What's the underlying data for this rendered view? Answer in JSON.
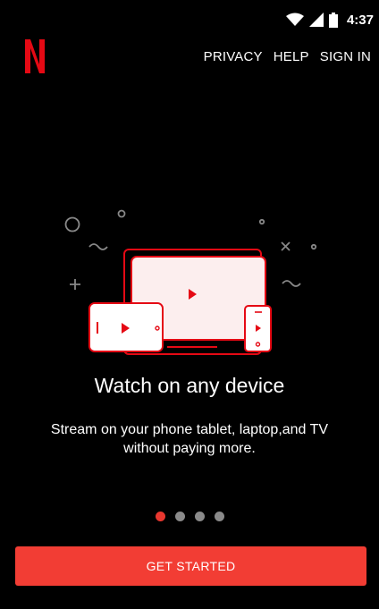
{
  "status_bar": {
    "time": "4:37",
    "icons": [
      "wifi-icon",
      "cell-signal-icon",
      "battery-icon"
    ]
  },
  "header": {
    "logo": "netflix-logo",
    "nav": [
      {
        "label": "PRIVACY"
      },
      {
        "label": "HELP"
      },
      {
        "label": "SIGN IN"
      }
    ]
  },
  "onboarding": {
    "illustration": "devices-illustration",
    "title": "Watch on any device",
    "description": "Stream on your phone tablet, laptop,and TV without paying more.",
    "pager": {
      "pages": 4,
      "current": 1
    }
  },
  "cta": {
    "label": "GET STARTED"
  },
  "colors": {
    "brand": "#e50914",
    "accent": "#f23d34",
    "dot_inactive": "#8a8a8a"
  }
}
